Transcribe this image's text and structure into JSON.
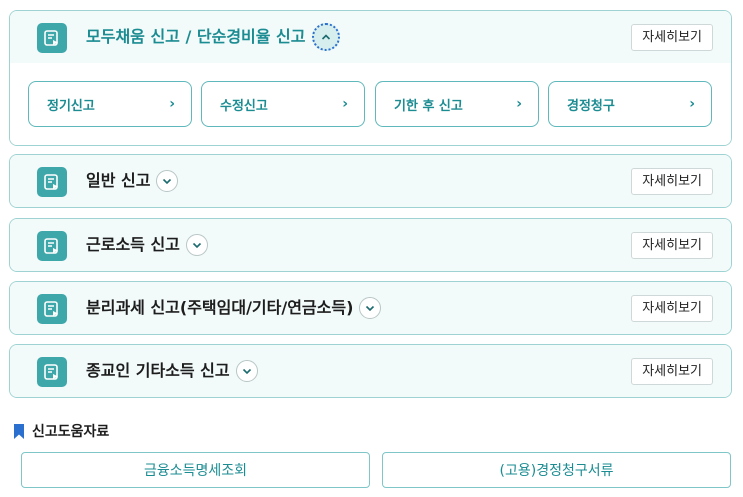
{
  "sections": [
    {
      "title": "모두채움 신고 / 단순경비율 신고",
      "detail_label": "자세히보기",
      "expanded": true,
      "sub_buttons": [
        {
          "label": "정기신고"
        },
        {
          "label": "수정신고"
        },
        {
          "label": "기한 후 신고"
        },
        {
          "label": "경정청구"
        }
      ]
    },
    {
      "title": "일반 신고",
      "detail_label": "자세히보기",
      "expanded": false
    },
    {
      "title": "근로소득 신고",
      "detail_label": "자세히보기",
      "expanded": false
    },
    {
      "title": "분리과세 신고(주택임대/기타/연금소득)",
      "detail_label": "자세히보기",
      "expanded": false
    },
    {
      "title": "종교인 기타소득 신고",
      "detail_label": "자세히보기",
      "expanded": false
    }
  ],
  "help": {
    "title": "신고도움자료",
    "links": [
      {
        "label": "금융소득명세조회"
      },
      {
        "label": "(고용)경정청구서류"
      }
    ]
  },
  "colors": {
    "accent": "#1b8c92",
    "icon_bg": "#3ea7a9",
    "border": "#9fd3d3",
    "bookmark": "#2b6fcf"
  },
  "icons": {
    "section": "document-icon",
    "expand": "chevron-down-icon",
    "collapse": "chevron-up-icon",
    "sub_button": "chevron-right-icon",
    "help": "bookmark-icon"
  }
}
